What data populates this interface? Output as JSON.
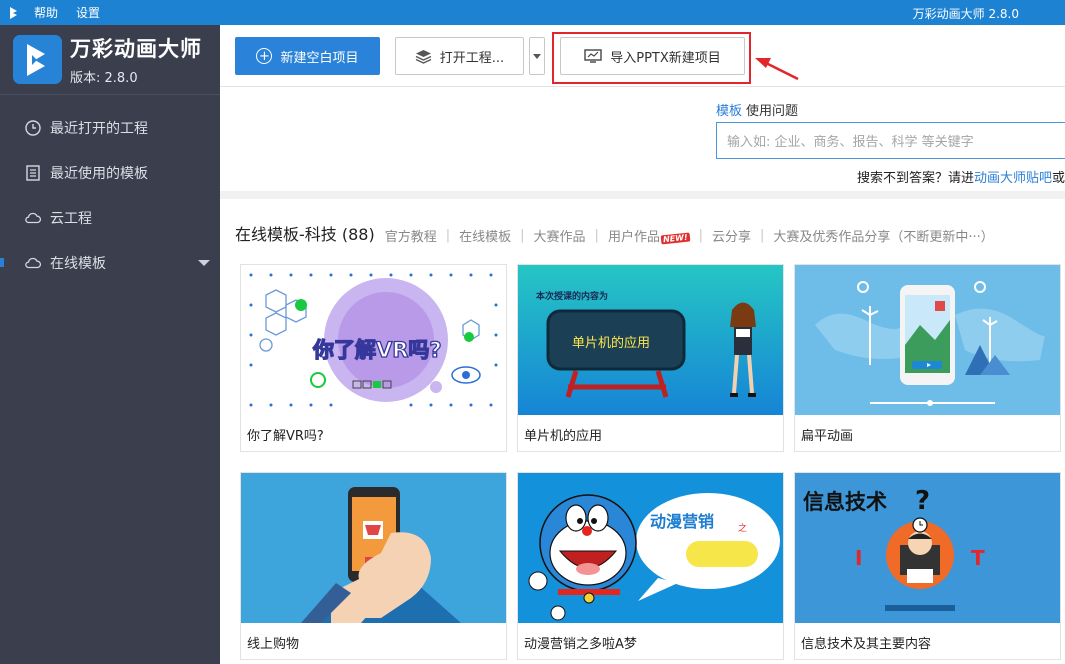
{
  "topbar": {
    "menus": [
      "帮助",
      "设置"
    ],
    "title": "万彩动画大师 2.8.0"
  },
  "brand": {
    "name": "万彩动画大师",
    "version": "版本: 2.8.0"
  },
  "sidebar": {
    "items": [
      {
        "label": "最近打开的工程",
        "icon": "clock-icon"
      },
      {
        "label": "最近使用的模板",
        "icon": "template-list-icon"
      },
      {
        "label": "云工程",
        "icon": "cloud-icon"
      },
      {
        "label": "在线模板",
        "icon": "cloud-icon"
      }
    ]
  },
  "toolbar": {
    "new_label": "新建空白项目",
    "open_label": "打开工程...",
    "import_label": "导入PPTX新建项目"
  },
  "search": {
    "tabs": [
      "模板",
      "使用问题"
    ],
    "placeholder": "输入如: 企业、商务、报告、科学 等关键字",
    "help_prefix": "搜索不到答案？请进",
    "help_link": "动画大师贴吧",
    "help_suffix": "或"
  },
  "section": {
    "title": "在线模板-科技 (88)",
    "links": [
      "官方教程",
      "在线模板",
      "大赛作品",
      "用户作品",
      "云分享",
      "大赛及优秀作品分享（不断更新中···）"
    ],
    "new_badge": "NEW!"
  },
  "templates": [
    {
      "title": "你了解VR吗?",
      "thumb_text": "你了解VR吗?",
      "bg": "#ffffff"
    },
    {
      "title": "单片机的应用",
      "thumb_text": "单片机的应用",
      "thumb_sub": "本次授课的内容为",
      "bg": "#1a9fd8"
    },
    {
      "title": "扁平动画",
      "bg": "#66b8e6"
    },
    {
      "title": "线上购物",
      "bg": "#3ea4dc"
    },
    {
      "title": "动漫营销之多啦A梦",
      "thumb_text": "动漫营销",
      "thumb_small": "之",
      "bg": "#1491db"
    },
    {
      "title": "信息技术及其主要内容",
      "thumb_text": "信息技术",
      "thumb_i": "I",
      "thumb_t": "T",
      "bg": "#3c96d8"
    }
  ]
}
